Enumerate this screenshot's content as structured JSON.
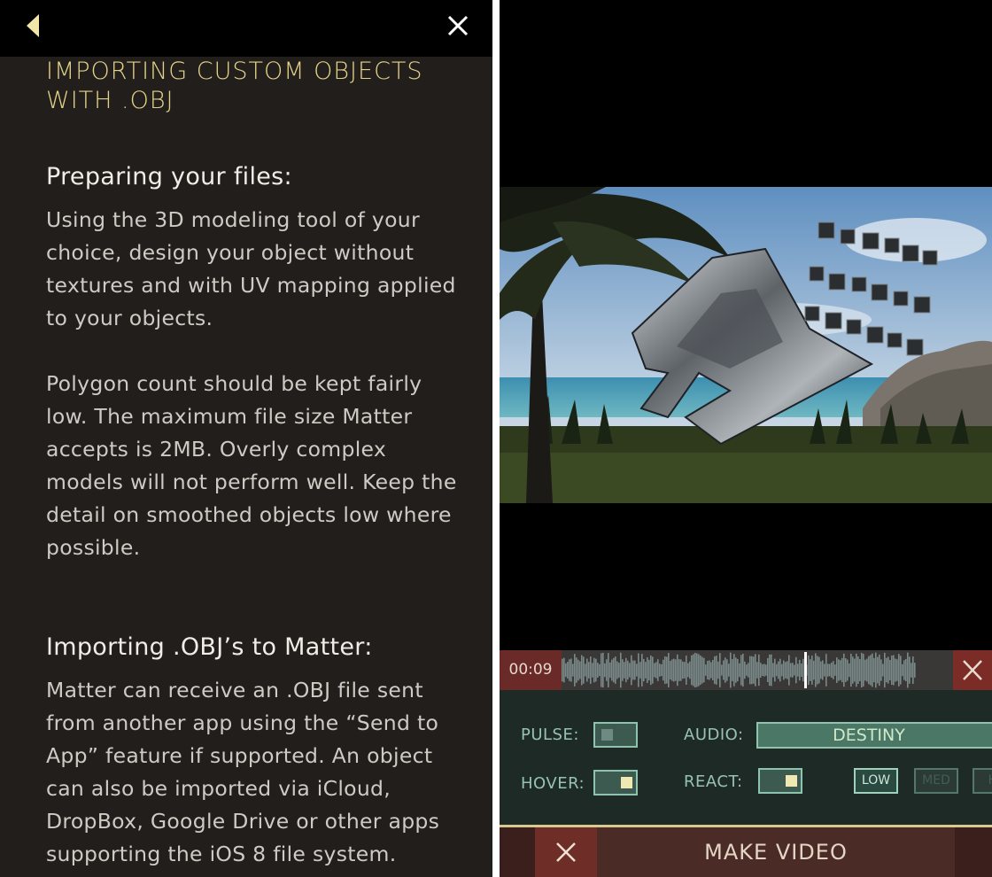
{
  "help": {
    "title": "IMPORTING CUSTOM OBJECTS WITH .OBJ",
    "sections": [
      {
        "heading": "Preparing your files:",
        "paragraphs": [
          "Using the 3D modeling tool of your choice, design your object without textures and with UV mapping applied to your objects.",
          "Polygon count should be kept fairly low. The maximum file size Matter accepts is 2MB. Overly complex models will not perform well. Keep the detail on smoothed objects low where possible."
        ]
      },
      {
        "heading": "Importing .OBJ’s to Matter:",
        "paragraphs": [
          "Matter can receive an .OBJ file sent from another app using the “Send to App” feature if supported. An object can also be imported via iCloud, DropBox, Google Drive or other apps supporting the iOS 8 file system."
        ]
      }
    ],
    "icons": {
      "back": "back-arrow-icon",
      "close": "close-icon"
    }
  },
  "editor": {
    "timeline": {
      "time": "00:09",
      "playhead_position": 0.62
    },
    "controls": {
      "pulse_label": "PULSE:",
      "pulse_on": false,
      "hover_label": "HOVER:",
      "hover_on": true,
      "audio_label": "AUDIO:",
      "audio_track": "DESTINY",
      "react_label": "REACT:",
      "react_on": true,
      "levels": [
        "LOW",
        "MED",
        "HI"
      ],
      "selected_level": "LOW"
    },
    "make_video_label": "MAKE VIDEO"
  },
  "colors": {
    "title_yellow": "#e3d389",
    "panel_bg": "#221e1c",
    "control_green": "#4a7766",
    "red_accent": "#7b2c26"
  }
}
